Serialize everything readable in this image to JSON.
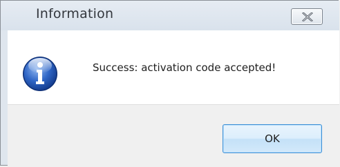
{
  "dialog": {
    "title": "Information",
    "message": "Success: activation code accepted!",
    "ok_label": "OK",
    "icon": "info-icon",
    "close_icon": "close-icon"
  },
  "colors": {
    "content_bg": "#ffffff",
    "footer_bg": "#f0f0f0",
    "titlebar_bg": "#dfe6ee",
    "button_border": "#3d8fd6",
    "icon_blue": "#1f4fa8"
  }
}
